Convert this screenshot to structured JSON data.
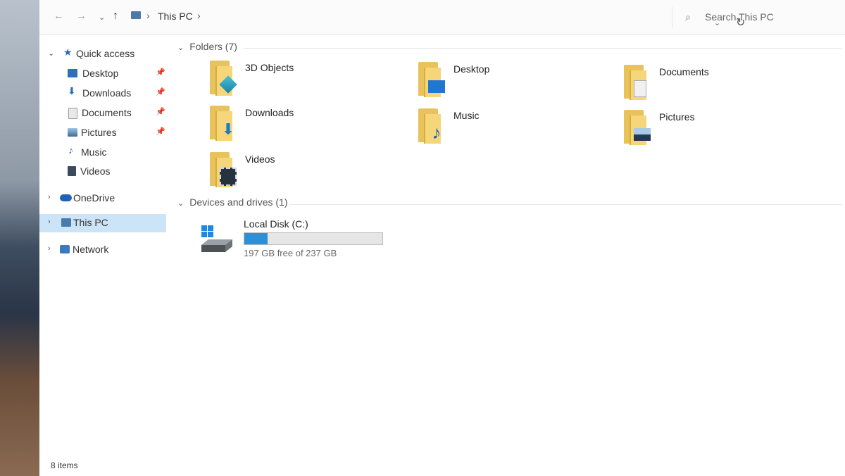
{
  "window": {
    "title": "This PC"
  },
  "address": {
    "path": "This PC",
    "search_placeholder": "Search This PC"
  },
  "sidebar": {
    "items": [
      {
        "label": "Quick access",
        "pinned": false
      },
      {
        "label": "Desktop",
        "pinned": true
      },
      {
        "label": "Downloads",
        "pinned": true
      },
      {
        "label": "Documents",
        "pinned": true
      },
      {
        "label": "Pictures",
        "pinned": true
      },
      {
        "label": "Music",
        "pinned": false
      },
      {
        "label": "Videos",
        "pinned": false
      },
      {
        "label": "OneDrive",
        "pinned": false
      },
      {
        "label": "This PC",
        "pinned": false,
        "selected": true
      },
      {
        "label": "Network",
        "pinned": false
      }
    ]
  },
  "content": {
    "folders_header": "Folders (7)",
    "folders": [
      {
        "label": "3D Objects",
        "icon": "3d-objects-icon"
      },
      {
        "label": "Desktop",
        "icon": "desktop-icon"
      },
      {
        "label": "Documents",
        "icon": "documents-icon"
      },
      {
        "label": "Downloads",
        "icon": "downloads-icon"
      },
      {
        "label": "Music",
        "icon": "music-icon"
      },
      {
        "label": "Pictures",
        "icon": "pictures-icon"
      },
      {
        "label": "Videos",
        "icon": "videos-icon"
      }
    ],
    "devices_header": "Devices and drives (1)",
    "drive": {
      "label": "Local Disk (C:)",
      "free_text": "197 GB free of 237 GB",
      "used_fraction": 0.17
    }
  },
  "status": {
    "items": "8 items"
  },
  "colors": {
    "selection": "#cce4f7",
    "drive_bar": "#2f8fd4",
    "folder": "#f5d67a"
  }
}
